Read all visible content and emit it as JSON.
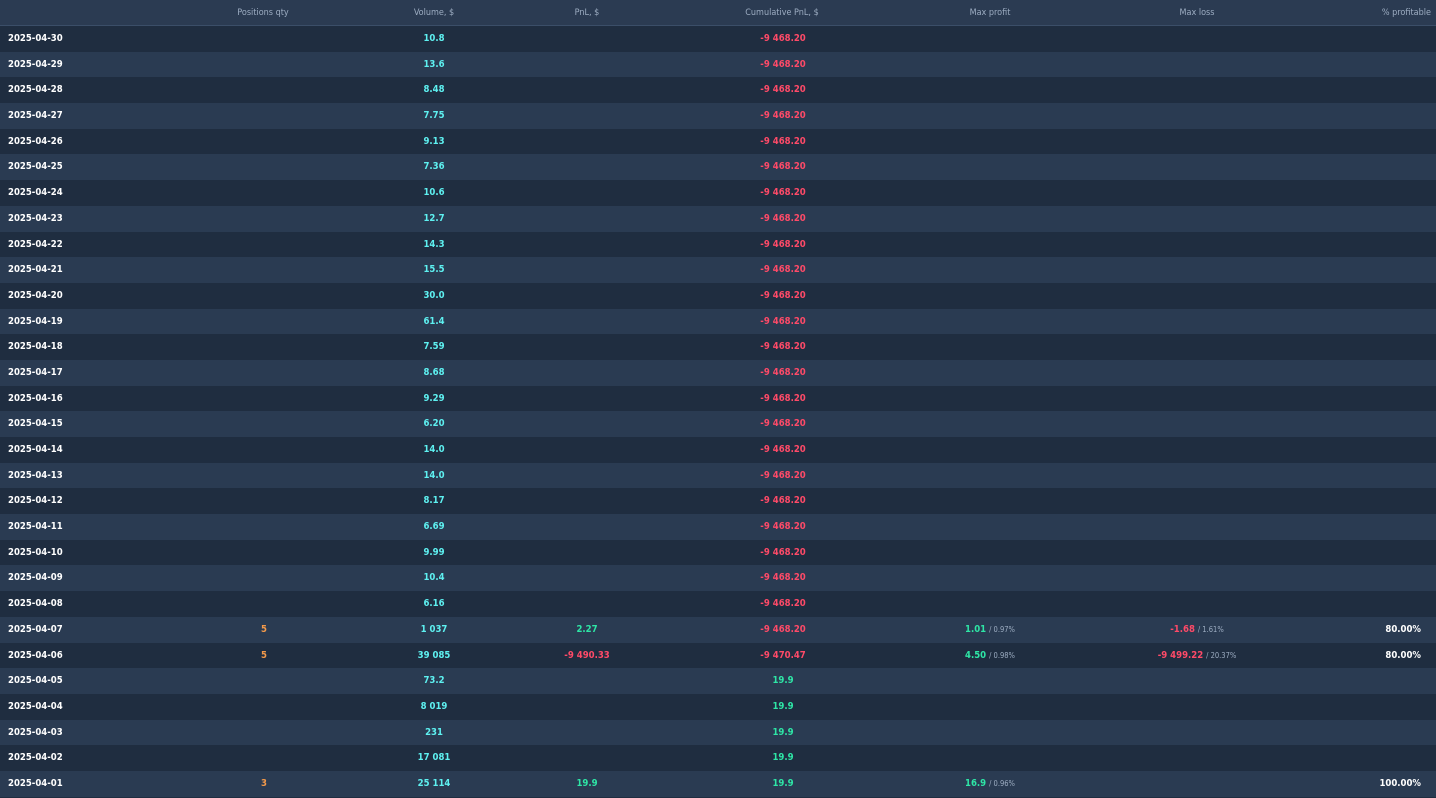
{
  "columns": [
    {
      "key": "positions_qty",
      "label": "Positions qty"
    },
    {
      "key": "volume",
      "label": "Volume, $"
    },
    {
      "key": "pnl",
      "label": "PnL, $"
    },
    {
      "key": "cumulative_pnl",
      "label": "Cumulative PnL, $"
    },
    {
      "key": "max_profit",
      "label": "Max profit"
    },
    {
      "key": "max_loss",
      "label": "Max loss"
    },
    {
      "key": "pct_profitable",
      "label": "% profitable"
    }
  ],
  "colors": {
    "background": "#1f2d40",
    "row_alt": "#2a3b52",
    "header_text": "#9dadc2",
    "volume": "#5ef1f1",
    "positive": "#2ee6a6",
    "negative": "#ff4a68",
    "qty": "#f2994a"
  },
  "rows": [
    {
      "date": "2025-04-30",
      "qty": "",
      "volume": "10.8",
      "pnl": "",
      "cum": "-9 468.20",
      "max_profit": "",
      "max_profit_pct": "",
      "max_loss": "",
      "max_loss_pct": "",
      "profitable": ""
    },
    {
      "date": "2025-04-29",
      "qty": "",
      "volume": "13.6",
      "pnl": "",
      "cum": "-9 468.20",
      "max_profit": "",
      "max_profit_pct": "",
      "max_loss": "",
      "max_loss_pct": "",
      "profitable": ""
    },
    {
      "date": "2025-04-28",
      "qty": "",
      "volume": "8.48",
      "pnl": "",
      "cum": "-9 468.20",
      "max_profit": "",
      "max_profit_pct": "",
      "max_loss": "",
      "max_loss_pct": "",
      "profitable": ""
    },
    {
      "date": "2025-04-27",
      "qty": "",
      "volume": "7.75",
      "pnl": "",
      "cum": "-9 468.20",
      "max_profit": "",
      "max_profit_pct": "",
      "max_loss": "",
      "max_loss_pct": "",
      "profitable": ""
    },
    {
      "date": "2025-04-26",
      "qty": "",
      "volume": "9.13",
      "pnl": "",
      "cum": "-9 468.20",
      "max_profit": "",
      "max_profit_pct": "",
      "max_loss": "",
      "max_loss_pct": "",
      "profitable": ""
    },
    {
      "date": "2025-04-25",
      "qty": "",
      "volume": "7.36",
      "pnl": "",
      "cum": "-9 468.20",
      "max_profit": "",
      "max_profit_pct": "",
      "max_loss": "",
      "max_loss_pct": "",
      "profitable": ""
    },
    {
      "date": "2025-04-24",
      "qty": "",
      "volume": "10.6",
      "pnl": "",
      "cum": "-9 468.20",
      "max_profit": "",
      "max_profit_pct": "",
      "max_loss": "",
      "max_loss_pct": "",
      "profitable": ""
    },
    {
      "date": "2025-04-23",
      "qty": "",
      "volume": "12.7",
      "pnl": "",
      "cum": "-9 468.20",
      "max_profit": "",
      "max_profit_pct": "",
      "max_loss": "",
      "max_loss_pct": "",
      "profitable": ""
    },
    {
      "date": "2025-04-22",
      "qty": "",
      "volume": "14.3",
      "pnl": "",
      "cum": "-9 468.20",
      "max_profit": "",
      "max_profit_pct": "",
      "max_loss": "",
      "max_loss_pct": "",
      "profitable": ""
    },
    {
      "date": "2025-04-21",
      "qty": "",
      "volume": "15.5",
      "pnl": "",
      "cum": "-9 468.20",
      "max_profit": "",
      "max_profit_pct": "",
      "max_loss": "",
      "max_loss_pct": "",
      "profitable": ""
    },
    {
      "date": "2025-04-20",
      "qty": "",
      "volume": "30.0",
      "pnl": "",
      "cum": "-9 468.20",
      "max_profit": "",
      "max_profit_pct": "",
      "max_loss": "",
      "max_loss_pct": "",
      "profitable": ""
    },
    {
      "date": "2025-04-19",
      "qty": "",
      "volume": "61.4",
      "pnl": "",
      "cum": "-9 468.20",
      "max_profit": "",
      "max_profit_pct": "",
      "max_loss": "",
      "max_loss_pct": "",
      "profitable": ""
    },
    {
      "date": "2025-04-18",
      "qty": "",
      "volume": "7.59",
      "pnl": "",
      "cum": "-9 468.20",
      "max_profit": "",
      "max_profit_pct": "",
      "max_loss": "",
      "max_loss_pct": "",
      "profitable": ""
    },
    {
      "date": "2025-04-17",
      "qty": "",
      "volume": "8.68",
      "pnl": "",
      "cum": "-9 468.20",
      "max_profit": "",
      "max_profit_pct": "",
      "max_loss": "",
      "max_loss_pct": "",
      "profitable": ""
    },
    {
      "date": "2025-04-16",
      "qty": "",
      "volume": "9.29",
      "pnl": "",
      "cum": "-9 468.20",
      "max_profit": "",
      "max_profit_pct": "",
      "max_loss": "",
      "max_loss_pct": "",
      "profitable": ""
    },
    {
      "date": "2025-04-15",
      "qty": "",
      "volume": "6.20",
      "pnl": "",
      "cum": "-9 468.20",
      "max_profit": "",
      "max_profit_pct": "",
      "max_loss": "",
      "max_loss_pct": "",
      "profitable": ""
    },
    {
      "date": "2025-04-14",
      "qty": "",
      "volume": "14.0",
      "pnl": "",
      "cum": "-9 468.20",
      "max_profit": "",
      "max_profit_pct": "",
      "max_loss": "",
      "max_loss_pct": "",
      "profitable": ""
    },
    {
      "date": "2025-04-13",
      "qty": "",
      "volume": "14.0",
      "pnl": "",
      "cum": "-9 468.20",
      "max_profit": "",
      "max_profit_pct": "",
      "max_loss": "",
      "max_loss_pct": "",
      "profitable": ""
    },
    {
      "date": "2025-04-12",
      "qty": "",
      "volume": "8.17",
      "pnl": "",
      "cum": "-9 468.20",
      "max_profit": "",
      "max_profit_pct": "",
      "max_loss": "",
      "max_loss_pct": "",
      "profitable": ""
    },
    {
      "date": "2025-04-11",
      "qty": "",
      "volume": "6.69",
      "pnl": "",
      "cum": "-9 468.20",
      "max_profit": "",
      "max_profit_pct": "",
      "max_loss": "",
      "max_loss_pct": "",
      "profitable": ""
    },
    {
      "date": "2025-04-10",
      "qty": "",
      "volume": "9.99",
      "pnl": "",
      "cum": "-9 468.20",
      "max_profit": "",
      "max_profit_pct": "",
      "max_loss": "",
      "max_loss_pct": "",
      "profitable": ""
    },
    {
      "date": "2025-04-09",
      "qty": "",
      "volume": "10.4",
      "pnl": "",
      "cum": "-9 468.20",
      "max_profit": "",
      "max_profit_pct": "",
      "max_loss": "",
      "max_loss_pct": "",
      "profitable": ""
    },
    {
      "date": "2025-04-08",
      "qty": "",
      "volume": "6.16",
      "pnl": "",
      "cum": "-9 468.20",
      "max_profit": "",
      "max_profit_pct": "",
      "max_loss": "",
      "max_loss_pct": "",
      "profitable": ""
    },
    {
      "date": "2025-04-07",
      "qty": "5",
      "volume": "1 037",
      "pnl": "2.27",
      "cum": "-9 468.20",
      "max_profit": "1.01",
      "max_profit_pct": "/ 0.97%",
      "max_loss": "-1.68",
      "max_loss_pct": "/ 1.61%",
      "profitable": "80.00%"
    },
    {
      "date": "2025-04-06",
      "qty": "5",
      "volume": "39 085",
      "pnl": "-9 490.33",
      "cum": "-9 470.47",
      "max_profit": "4.50",
      "max_profit_pct": "/ 0.98%",
      "max_loss": "-9 499.22",
      "max_loss_pct": "/ 20.37%",
      "profitable": "80.00%"
    },
    {
      "date": "2025-04-05",
      "qty": "",
      "volume": "73.2",
      "pnl": "",
      "cum": "19.9",
      "max_profit": "",
      "max_profit_pct": "",
      "max_loss": "",
      "max_loss_pct": "",
      "profitable": ""
    },
    {
      "date": "2025-04-04",
      "qty": "",
      "volume": "8 019",
      "pnl": "",
      "cum": "19.9",
      "max_profit": "",
      "max_profit_pct": "",
      "max_loss": "",
      "max_loss_pct": "",
      "profitable": ""
    },
    {
      "date": "2025-04-03",
      "qty": "",
      "volume": "231",
      "pnl": "",
      "cum": "19.9",
      "max_profit": "",
      "max_profit_pct": "",
      "max_loss": "",
      "max_loss_pct": "",
      "profitable": ""
    },
    {
      "date": "2025-04-02",
      "qty": "",
      "volume": "17 081",
      "pnl": "",
      "cum": "19.9",
      "max_profit": "",
      "max_profit_pct": "",
      "max_loss": "",
      "max_loss_pct": "",
      "profitable": ""
    },
    {
      "date": "2025-04-01",
      "qty": "3",
      "volume": "25 114",
      "pnl": "19.9",
      "cum": "19.9",
      "max_profit": "16.9",
      "max_profit_pct": "/ 0.96%",
      "max_loss": "",
      "max_loss_pct": "",
      "profitable": "100.00%"
    }
  ]
}
